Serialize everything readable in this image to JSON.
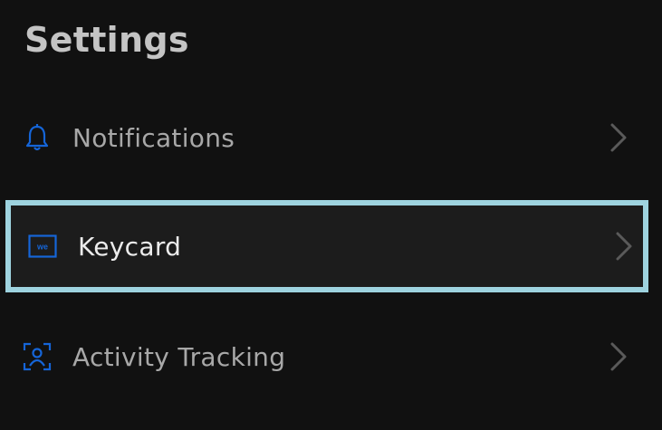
{
  "page": {
    "title": "Settings"
  },
  "items": [
    {
      "id": "notifications",
      "label": "Notifications",
      "icon": "bell-icon",
      "selected": false
    },
    {
      "id": "keycard",
      "label": "Keycard",
      "icon": "we-keycard-icon",
      "icon_text": "we",
      "selected": true
    },
    {
      "id": "activity",
      "label": "Activity Tracking",
      "icon": "person-scan-icon",
      "selected": false
    }
  ],
  "colors": {
    "background": "#111111",
    "title": "#c4c4c4",
    "label": "#a8a8a8",
    "label_selected": "#ececec",
    "icon_accent": "#1565d8",
    "chevron": "#5a5a5a",
    "selection_border": "#9ed3df",
    "selection_background": "#1c1c1c"
  }
}
